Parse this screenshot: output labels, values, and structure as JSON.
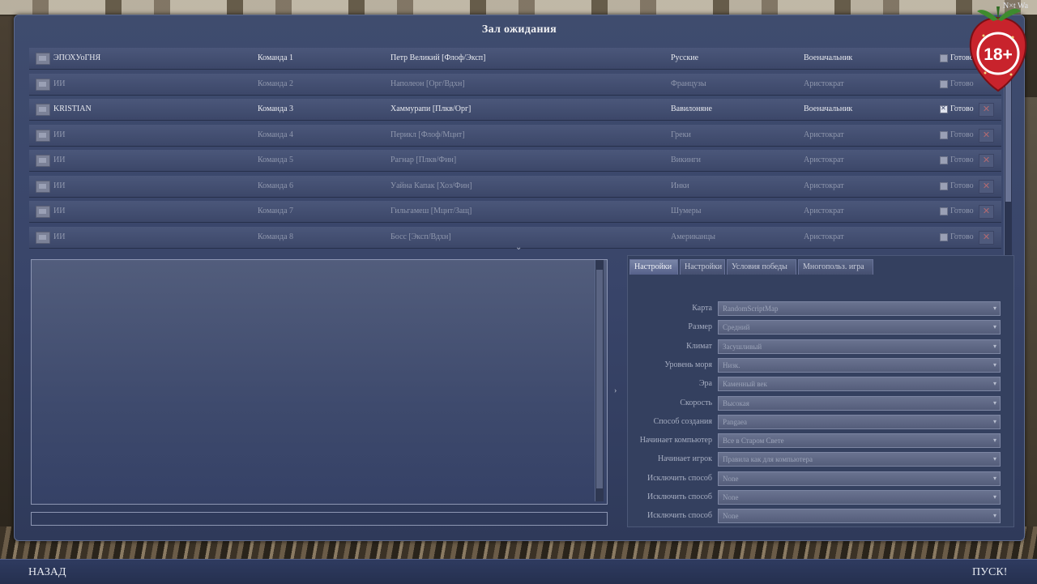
{
  "window": {
    "title": "Зал ожидания"
  },
  "watermark": "N×t Wa",
  "badge": {
    "age": "18+"
  },
  "players": [
    {
      "name": "ЭПОХУоГНЯ",
      "team": "Команда 1",
      "leader": "Петр Великий [Флоф/Эксп]",
      "civ": "Русские",
      "trait": "Военачальник",
      "ready_label": "Готово",
      "ready": false,
      "human": true,
      "kick": false
    },
    {
      "name": "ИИ",
      "team": "Команда 2",
      "leader": "Наполеон [Орг/Вдхн]",
      "civ": "Французы",
      "trait": "Аристократ",
      "ready_label": "Готово",
      "ready": false,
      "human": false,
      "kick": false
    },
    {
      "name": "KRISTIAN",
      "team": "Команда 3",
      "leader": "Хаммурапи [Плкв/Орг]",
      "civ": "Вавилоняне",
      "trait": "Военачальник",
      "ready_label": "Готово",
      "ready": true,
      "human": true,
      "kick": true
    },
    {
      "name": "ИИ",
      "team": "Команда 4",
      "leader": "Перикл [Флоф/Мцнт]",
      "civ": "Греки",
      "trait": "Аристократ",
      "ready_label": "Готово",
      "ready": false,
      "human": false,
      "kick": true
    },
    {
      "name": "ИИ",
      "team": "Команда 5",
      "leader": "Рагнар [Плкв/Фин]",
      "civ": "Викинги",
      "trait": "Аристократ",
      "ready_label": "Готово",
      "ready": false,
      "human": false,
      "kick": true
    },
    {
      "name": "ИИ",
      "team": "Команда 6",
      "leader": "Уайна Капак [Хоз/Фин]",
      "civ": "Инки",
      "trait": "Аристократ",
      "ready_label": "Готово",
      "ready": false,
      "human": false,
      "kick": true
    },
    {
      "name": "ИИ",
      "team": "Команда 7",
      "leader": "Гильгамеш [Мцнт/Защ]",
      "civ": "Шумеры",
      "trait": "Аристократ",
      "ready_label": "Готово",
      "ready": false,
      "human": false,
      "kick": true
    },
    {
      "name": "ИИ",
      "team": "Команда 8",
      "leader": "Босс [Эксп/Вдхн]",
      "civ": "Американцы",
      "trait": "Аристократ",
      "ready_label": "Готово",
      "ready": false,
      "human": false,
      "kick": true
    }
  ],
  "tabs": [
    "Настройки",
    "Настройки",
    "Условия победы",
    "Многопольз. игра"
  ],
  "active_tab": 0,
  "settings": [
    {
      "label": "Карта",
      "value": "RandomScriptMap"
    },
    {
      "label": "Размер",
      "value": "Средний"
    },
    {
      "label": "Климат",
      "value": "Засушливый"
    },
    {
      "label": "Уровень моря",
      "value": "Низк."
    },
    {
      "label": "Эра",
      "value": "Каменный век"
    },
    {
      "label": "Скорость",
      "value": "Высокая"
    },
    {
      "label": "Способ создания",
      "value": "Pangaea"
    },
    {
      "label": "Начинает компьютер",
      "value": "Все в Старом Свете"
    },
    {
      "label": "Начинает игрок",
      "value": "Правила как для компьютера"
    },
    {
      "label": "Исключить способ",
      "value": "None"
    },
    {
      "label": "Исключить способ",
      "value": "None"
    },
    {
      "label": "Исключить способ",
      "value": "None"
    }
  ],
  "bottom": {
    "back_label": "НАЗАД",
    "start_label": "ПУСК!"
  },
  "colors": {
    "panel": "#3a4669",
    "accent": "#8d96b3",
    "kick": "#b06a72"
  }
}
